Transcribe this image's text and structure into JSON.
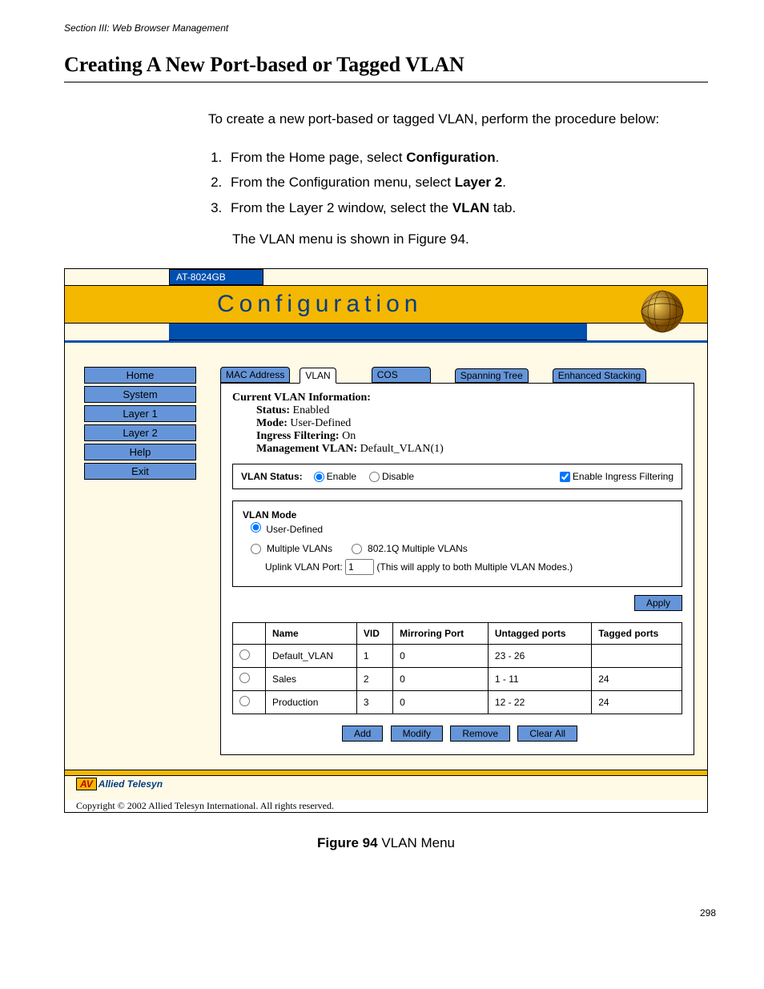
{
  "header": "Section III: Web Browser Management",
  "title": "Creating A New Port-based or Tagged VLAN",
  "intro": "To create a new port-based or tagged VLAN, perform the procedure below:",
  "steps": [
    {
      "pre": "From the Home page, select ",
      "bold": "Configuration",
      "post": "."
    },
    {
      "pre": "From the Configuration menu, select ",
      "bold": "Layer 2",
      "post": "."
    },
    {
      "pre": "From the Layer 2 window, select the ",
      "bold": "VLAN",
      "post": " tab."
    }
  ],
  "steps_follow": "The VLAN menu is shown in Figure 94.",
  "device": "AT-8024GB",
  "banner": "Configuration",
  "nav": [
    "Home",
    "System",
    "Layer 1",
    "Layer 2",
    "Help",
    "Exit"
  ],
  "tabs": {
    "mac": "MAC Address",
    "vlan": "VLAN",
    "cos": "COS",
    "spanning": "Spanning Tree",
    "stacking": "Enhanced Stacking"
  },
  "info": {
    "title": "Current VLAN Information:",
    "status": {
      "label": "Status:",
      "value": "Enabled"
    },
    "mode": {
      "label": "Mode:",
      "value": "User-Defined"
    },
    "ingress": {
      "label": "Ingress Filtering:",
      "value": "On"
    },
    "mgmt": {
      "label": "Management VLAN:",
      "value": "Default_VLAN(1)"
    }
  },
  "status_box": {
    "label": "VLAN Status:",
    "enable": "Enable",
    "disable": "Disable",
    "filter": "Enable Ingress Filtering"
  },
  "mode_box": {
    "title": "VLAN Mode",
    "user": "User-Defined",
    "multi": "Multiple VLANs",
    "q": "802.1Q Multiple VLANs",
    "uplink_label": "Uplink VLAN Port:",
    "uplink_value": "1",
    "uplink_note": "(This will apply to both Multiple VLAN Modes.)"
  },
  "apply": "Apply",
  "table": {
    "headers": [
      "Name",
      "VID",
      "Mirroring Port",
      "Untagged ports",
      "Tagged ports"
    ],
    "rows": [
      {
        "name": "Default_VLAN",
        "vid": "1",
        "mirror": "0",
        "untagged": "23 - 26",
        "tagged": ""
      },
      {
        "name": "Sales",
        "vid": "2",
        "mirror": "0",
        "untagged": "1 - 11",
        "tagged": "24"
      },
      {
        "name": "Production",
        "vid": "3",
        "mirror": "0",
        "untagged": "12 - 22",
        "tagged": "24"
      }
    ]
  },
  "buttons": {
    "add": "Add",
    "modify": "Modify",
    "remove": "Remove",
    "clear": "Clear All"
  },
  "brand": "Allied Telesyn",
  "copyright": "Copyright © 2002 Allied Telesyn International. All rights reserved.",
  "caption_num": "Figure 94",
  "caption_text": "  VLAN Menu",
  "page_num": "298"
}
